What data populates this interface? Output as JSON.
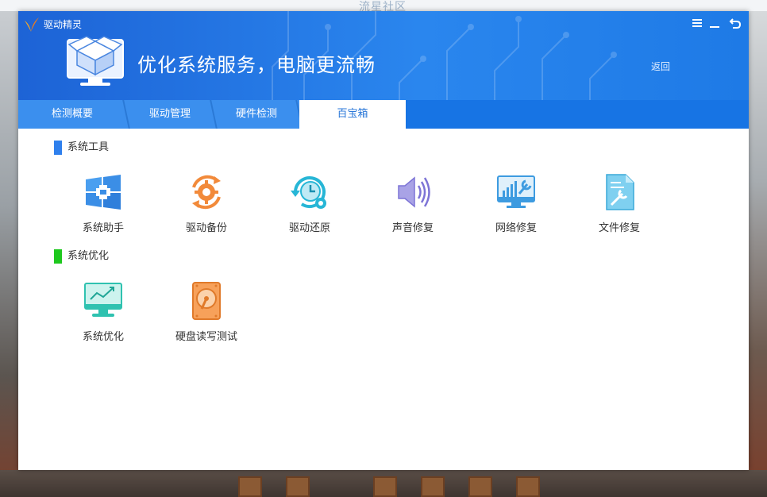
{
  "background": {
    "watermark": "流星社区"
  },
  "app": {
    "title": "驱动精灵",
    "hero_text": "优化系统服务，电脑更流畅",
    "back_label": "返回",
    "accent": "#1d63d6"
  },
  "window_controls": [
    {
      "name": "menu-icon"
    },
    {
      "name": "minimize-icon"
    },
    {
      "name": "back-arrow-icon"
    }
  ],
  "tabs": [
    {
      "label": "检测概要",
      "active": false
    },
    {
      "label": "驱动管理",
      "active": false
    },
    {
      "label": "硬件检测",
      "active": false
    },
    {
      "label": "百宝箱",
      "active": true
    }
  ],
  "sections": [
    {
      "title": "系统工具",
      "color": "#2f80ed",
      "tools": [
        {
          "label": "系统助手",
          "icon": "windows-plus-icon"
        },
        {
          "label": "驱动备份",
          "icon": "gear-sync-icon"
        },
        {
          "label": "驱动还原",
          "icon": "clock-restore-icon"
        },
        {
          "label": "声音修复",
          "icon": "speaker-icon"
        },
        {
          "label": "网络修复",
          "icon": "network-wrench-icon"
        },
        {
          "label": "文件修复",
          "icon": "file-wrench-icon"
        }
      ]
    },
    {
      "title": "系统优化",
      "color": "#1ec81e",
      "tools": [
        {
          "label": "系统优化",
          "icon": "monitor-chart-icon"
        },
        {
          "label": "硬盘读写测试",
          "icon": "hard-disk-icon"
        }
      ]
    }
  ]
}
